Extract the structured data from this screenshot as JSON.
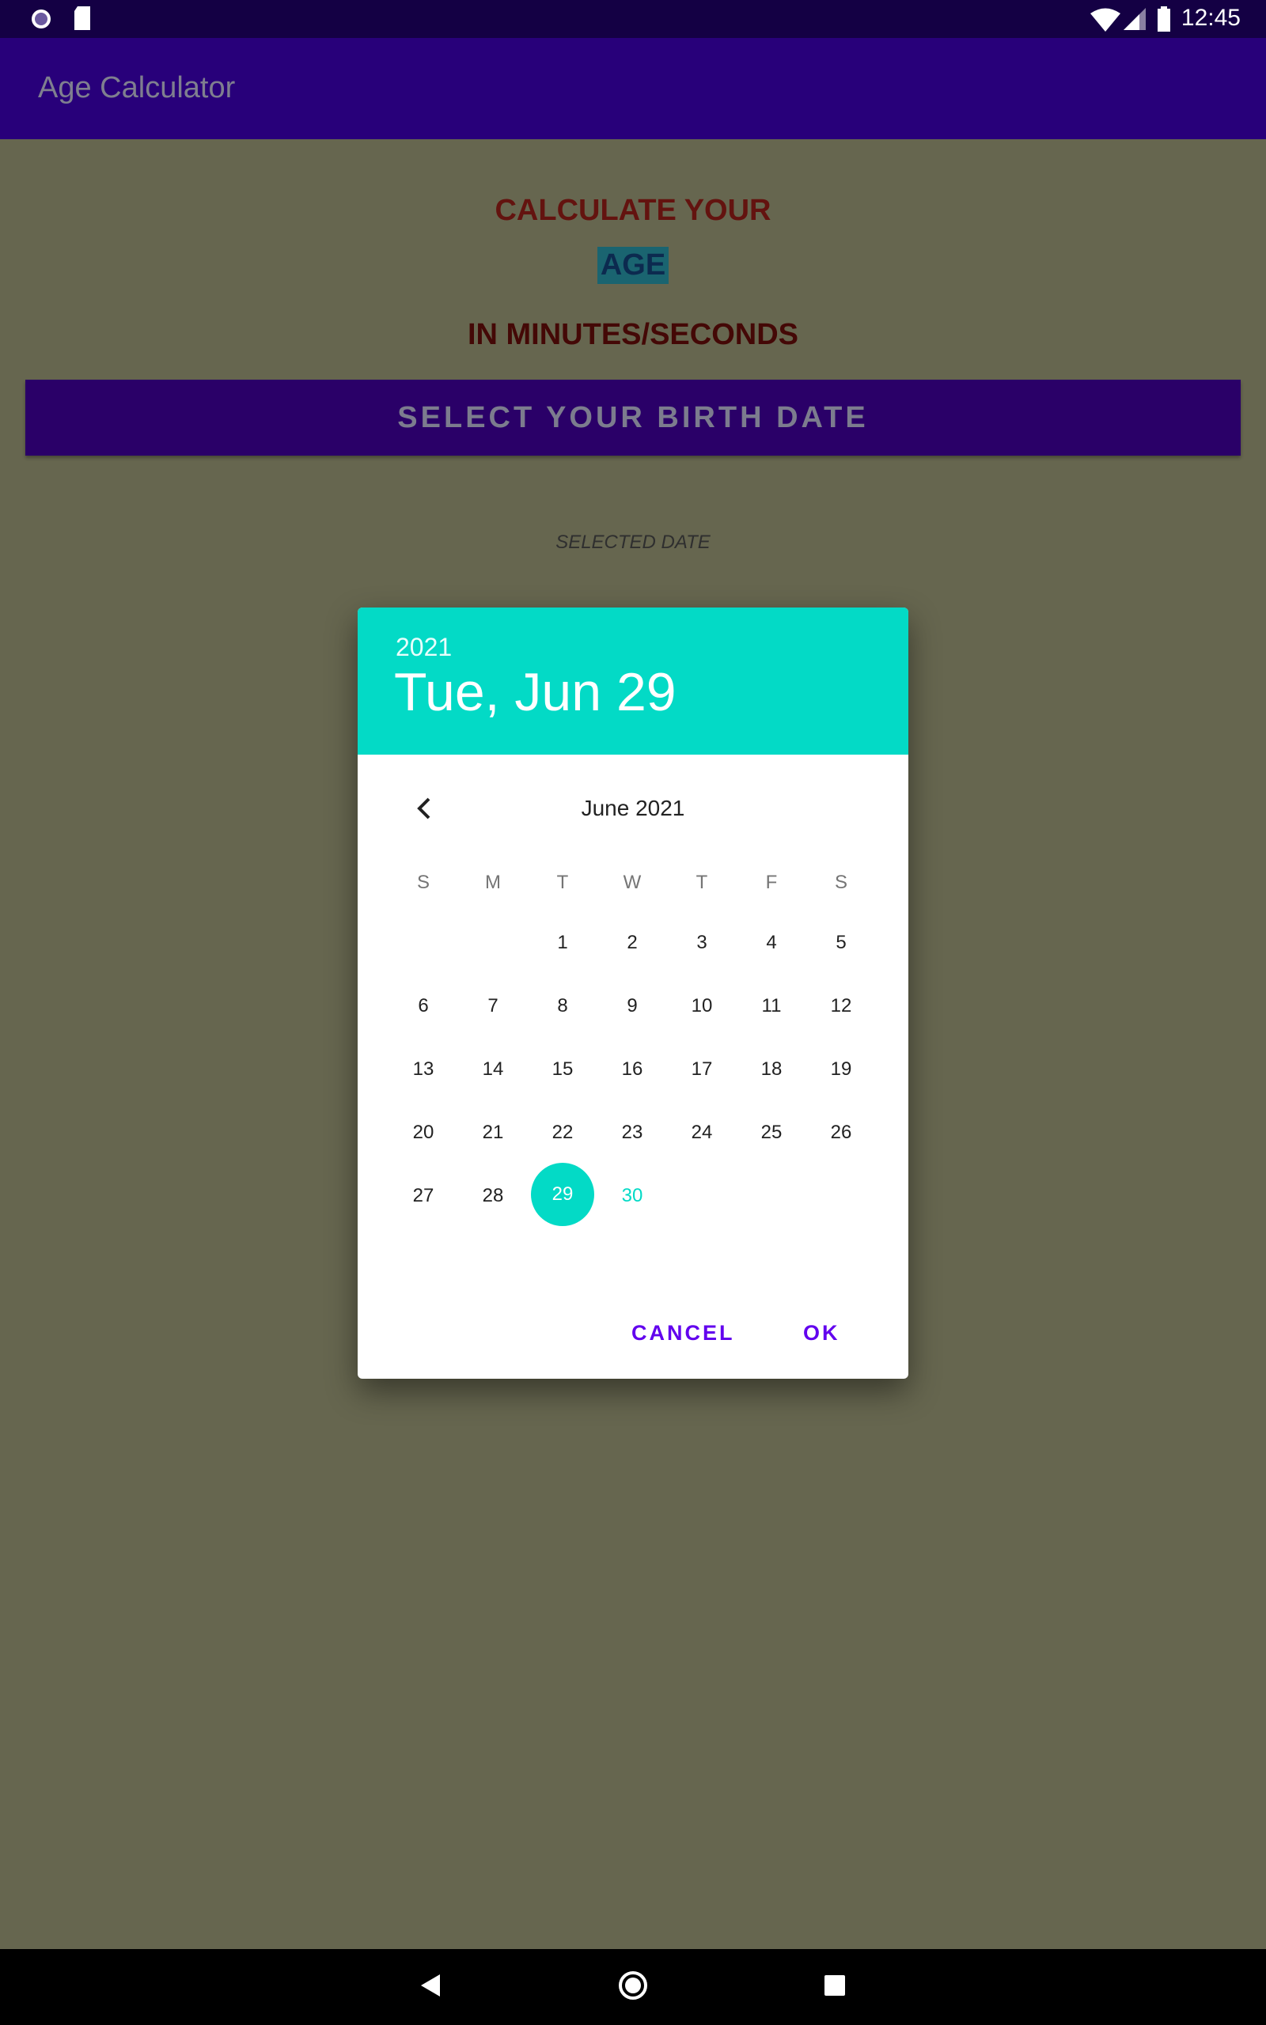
{
  "status_bar": {
    "time": "12:45",
    "left_icons": [
      "mind-icon",
      "sd-card-icon"
    ],
    "right_icons": [
      "wifi-icon",
      "signal-icon",
      "battery-icon"
    ]
  },
  "app_bar": {
    "title": "Age Calculator"
  },
  "main": {
    "line1": "CALCULATE YOUR",
    "line2": "AGE",
    "line3": "IN MINUTES/SECONDS",
    "select_button": "SELECT YOUR BIRTH DATE",
    "selected_date_label": "SELECTED DATE"
  },
  "dialog": {
    "year": "2021",
    "date": "Tue, Jun 29",
    "month_title": "June 2021",
    "weekdays": [
      "S",
      "M",
      "T",
      "W",
      "T",
      "F",
      "S"
    ],
    "days": [
      "1",
      "2",
      "3",
      "4",
      "5",
      "6",
      "7",
      "8",
      "9",
      "10",
      "11",
      "12",
      "13",
      "14",
      "15",
      "16",
      "17",
      "18",
      "19",
      "20",
      "21",
      "22",
      "23",
      "24",
      "25",
      "26",
      "27",
      "28",
      "29",
      "30"
    ],
    "selected_day": "29",
    "cancel": "CANCEL",
    "ok": "OK"
  },
  "colors": {
    "accent": "#03dac6",
    "primary_dark": "#140044",
    "primary": "#28007a",
    "button_text": "#6200ee"
  }
}
